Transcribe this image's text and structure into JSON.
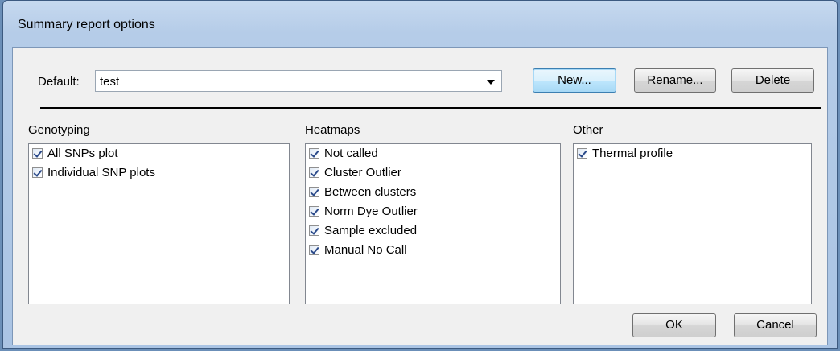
{
  "window": {
    "title": "Summary report options"
  },
  "default_row": {
    "label": "Default:",
    "selected_value": "test"
  },
  "buttons": {
    "new": "New...",
    "rename": "Rename...",
    "delete": "Delete",
    "ok": "OK",
    "cancel": "Cancel"
  },
  "groups": {
    "genotyping": {
      "title": "Genotyping",
      "items": [
        {
          "label": "All SNPs plot",
          "checked": true
        },
        {
          "label": "Individual SNP plots",
          "checked": true
        }
      ]
    },
    "heatmaps": {
      "title": "Heatmaps",
      "items": [
        {
          "label": "Not called",
          "checked": true
        },
        {
          "label": "Cluster Outlier",
          "checked": true
        },
        {
          "label": "Between clusters",
          "checked": true
        },
        {
          "label": "Norm Dye Outlier",
          "checked": true
        },
        {
          "label": "Sample excluded",
          "checked": true
        },
        {
          "label": "Manual No Call",
          "checked": true
        }
      ]
    },
    "other": {
      "title": "Other",
      "items": [
        {
          "label": "Thermal profile",
          "checked": true
        }
      ]
    }
  },
  "icons": {
    "dropdown": "chevron-down-icon",
    "checkbox": "checkbox-checked-icon"
  },
  "colors": {
    "titlebar": "#b5cce8",
    "client_bg": "#f0f0f0",
    "focus_border": "#3c7fb1"
  }
}
